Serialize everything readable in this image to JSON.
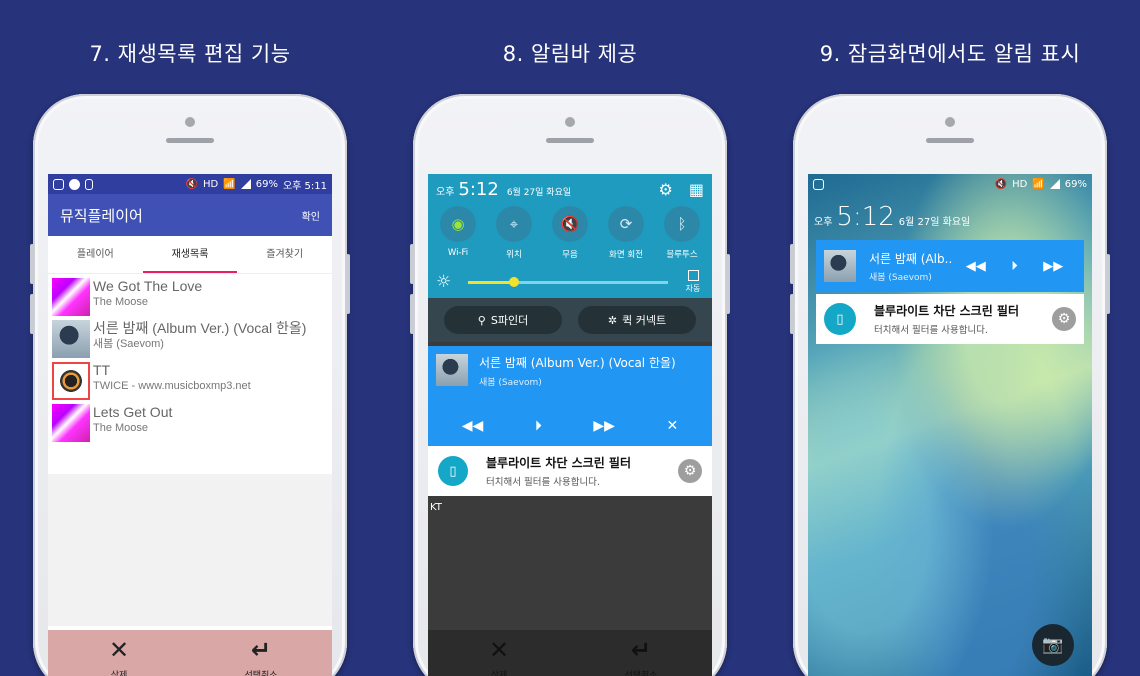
{
  "captions": {
    "c1": "7. 재생목록 편집 기능",
    "c2": "8. 알림바 제공",
    "c3": "9. 잠금화면에서도 알림 표시"
  },
  "phone1": {
    "status": {
      "left_icons": [
        "g-icon",
        "play-icon",
        "box-icon"
      ],
      "right_text": "69%",
      "time": "오후 5:11"
    },
    "appbar": {
      "title": "뮤직플레이어",
      "action": "확인"
    },
    "tabs": [
      {
        "label": "플레이어",
        "active": false
      },
      {
        "label": "재생목록",
        "active": true
      },
      {
        "label": "즐겨찾기",
        "active": false
      }
    ],
    "songs": [
      {
        "title": "We Got The Love",
        "artist": "The Moose",
        "thumb": "pink"
      },
      {
        "title": "서른 밤째 (Album Ver.) (Vocal 한올)",
        "artist": "새봄 (Saevom)",
        "thumb": "girl"
      },
      {
        "title": "TT",
        "artist": "TWICE - www.musicboxmp3.net",
        "thumb": "tt"
      },
      {
        "title": "Lets Get Out",
        "artist": "The Moose",
        "thumb": "pink"
      }
    ],
    "bottom": {
      "delete_icon": "✕",
      "delete": "삭제",
      "cancel_icon": "↵",
      "cancel": "선택취소"
    }
  },
  "phone2": {
    "header": {
      "ampm": "오후",
      "time": "5:12",
      "date": "6월 27일 화요일"
    },
    "toggles": [
      "Wi-Fi",
      "위치",
      "무음",
      "화면 회전",
      "블루투스"
    ],
    "brightness": {
      "level": 0.23,
      "auto_label": "자동"
    },
    "pills": {
      "finder": "S파인더",
      "quick": "퀵 커넥트"
    },
    "music": {
      "title": "서른 밤째 (Album Ver.) (Vocal 한올)",
      "artist": "새봄 (Saevom)"
    },
    "notif": {
      "title": "블루라이트 차단 스크린 필터",
      "sub": "터치해서 필터를 사용합니다."
    },
    "carrier": "KT",
    "bottom": {
      "delete": "삭제",
      "cancel": "선택취소"
    }
  },
  "phone3": {
    "status": {
      "battery": "69%"
    },
    "header": {
      "ampm": "오후",
      "time": "5:12",
      "date": "6월 27일 화요일"
    },
    "music": {
      "title": "서른 밤째 (Alb..",
      "artist": "새봄 (Saevom)"
    },
    "notif": {
      "title": "블루라이트 차단 스크린 필터",
      "sub": "터치해서 필터를 사용합니다."
    }
  },
  "colors": {
    "background": "#27337a",
    "primary": "#3f51b5",
    "accent": "#e91e63",
    "quick_panel": "#1e9bbf",
    "music_card": "#2196f3"
  }
}
